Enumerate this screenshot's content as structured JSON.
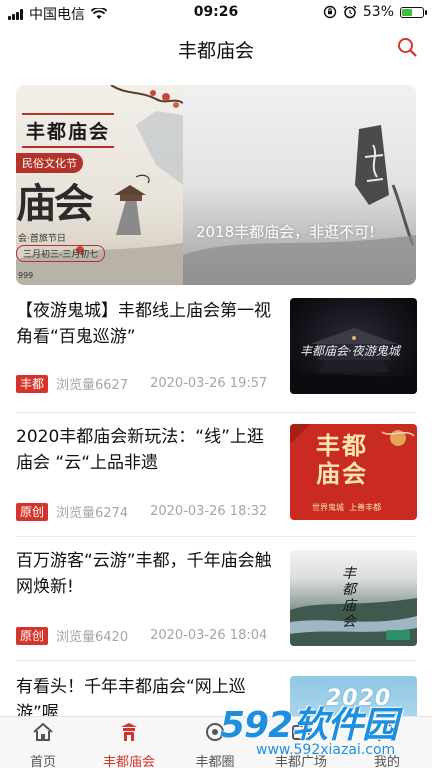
{
  "status_bar": {
    "carrier": "中国电信",
    "time": "09:26",
    "battery_percent": "53%",
    "battery_level": 0.53
  },
  "header": {
    "title": "丰都庙会",
    "search_icon": "search-icon",
    "accent_color": "#d3352d"
  },
  "banner": {
    "slide1": {
      "title": "丰都庙会",
      "subtitle": "民俗文化节",
      "big_text": "庙会",
      "small_text": "会·首旅节日",
      "pill_text": "三月初三-三月初七",
      "footer": "999"
    },
    "slide2": {
      "caption": "2018丰都庙会，非逛不可!"
    }
  },
  "articles": [
    {
      "title": "【夜游鬼城】丰都线上庙会第一视角看“百鬼巡游”",
      "tag": "丰都",
      "views": "浏览量6627",
      "date": "2020-03-26 19:57",
      "thumb_text": "丰都庙会·夜游鬼城"
    },
    {
      "title": "2020丰都庙会新玩法：“线”上逛庙会 “云“上品非遗",
      "tag": "原创",
      "views": "浏览量6274",
      "date": "2020-03-26 18:32",
      "thumb_title": "丰都庙会",
      "thumb_sub": "世界鬼城  上善丰都"
    },
    {
      "title": "百万游客“云游”丰都，千年庙会触网焕新!",
      "tag": "原创",
      "views": "浏览量6420",
      "date": "2020-03-26 18:04",
      "thumb_text": "丰都庙会"
    },
    {
      "title": "有看头！千年丰都庙会“网上巡游”喔",
      "thumb_text": "2020"
    }
  ],
  "tabbar": {
    "items": [
      {
        "label": "首页",
        "icon": "home-icon"
      },
      {
        "label": "丰都庙会",
        "icon": "temple-fair-icon"
      },
      {
        "label": "丰都圈",
        "icon": "circle-icon"
      },
      {
        "label": "丰都广场",
        "icon": "plaza-icon"
      },
      {
        "label": "我的",
        "icon": "profile-icon"
      }
    ],
    "active_index": 1
  },
  "watermark": {
    "brand": "592软件园",
    "url": "www.592xiazai.com"
  }
}
